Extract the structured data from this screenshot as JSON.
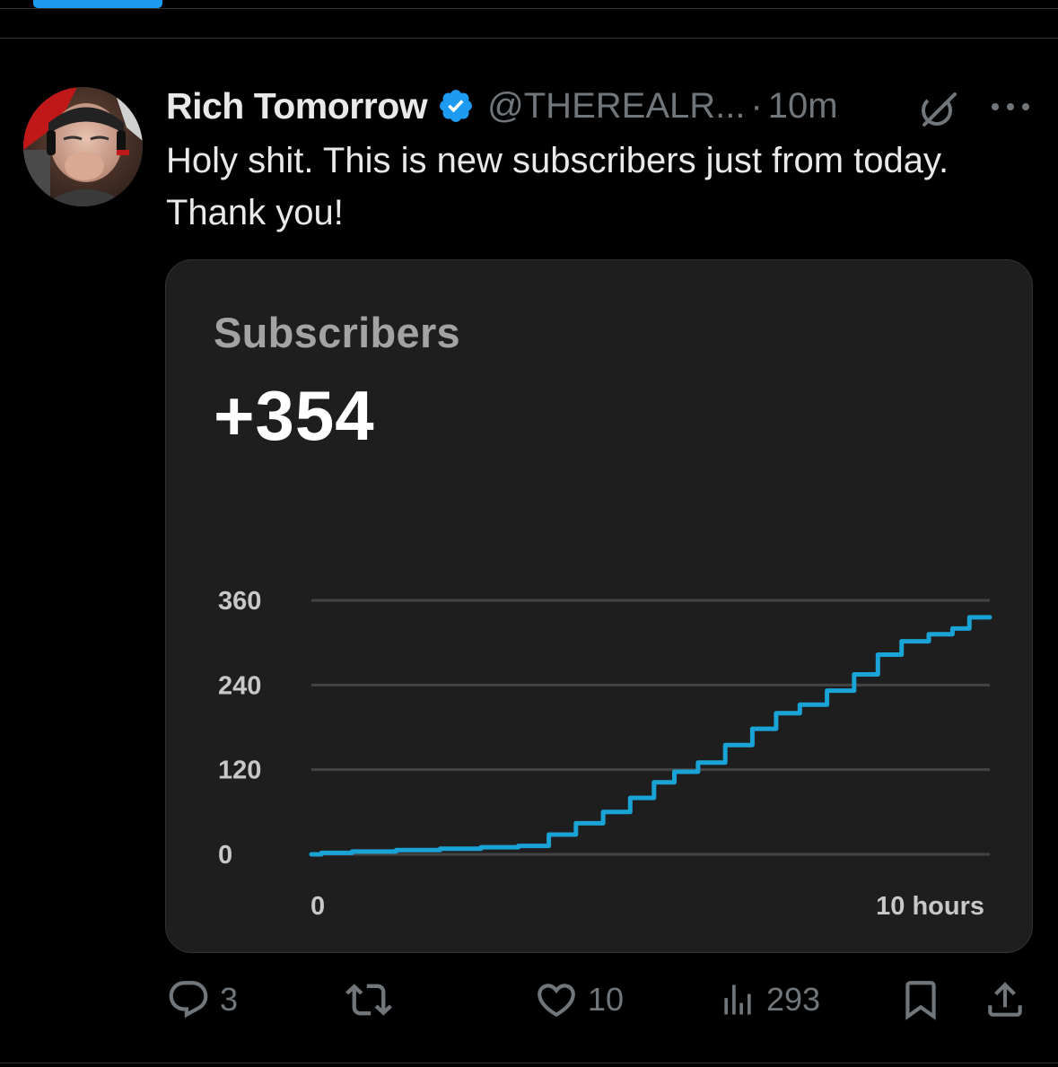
{
  "post": {
    "author": {
      "name": "Rich Tomorrow",
      "handle": "@THEREALR...",
      "verified": true,
      "verified_color": "#1d9bf0"
    },
    "separator": "·",
    "time": "10m",
    "text": "Holy shit. This is new subscribers just from today. Thank you!",
    "icons": {
      "grok": "grok-icon",
      "more": "more-icon"
    }
  },
  "card": {
    "title": "Subscribers",
    "value": "+354"
  },
  "chart_data": {
    "type": "line",
    "title": "",
    "xlabel": "",
    "ylabel": "",
    "x_tick_labels": [
      "0",
      "10 hours"
    ],
    "y_ticks": [
      0,
      120,
      240,
      360
    ],
    "xlim": [
      0,
      10
    ],
    "ylim": [
      0,
      360
    ],
    "grid": true,
    "line_color": "#1aa3d6",
    "series": [
      {
        "x": [
          0,
          0.3,
          0.9,
          1.6,
          2.2,
          2.8,
          3.3,
          3.7,
          4.1,
          4.5,
          4.9,
          5.2,
          5.5,
          5.9,
          6.3,
          6.7,
          7.0,
          7.4,
          7.8,
          8.2,
          8.5,
          8.9,
          9.3,
          9.6,
          9.8,
          10.0
        ],
        "y": [
          0,
          2,
          4,
          6,
          8,
          10,
          12,
          28,
          44,
          60,
          80,
          102,
          117,
          130,
          155,
          178,
          200,
          212,
          232,
          255,
          283,
          302,
          312,
          320,
          336,
          336
        ]
      }
    ]
  },
  "actions": {
    "reply": {
      "icon": "reply-icon",
      "count": "3"
    },
    "repost": {
      "icon": "repost-icon",
      "count": ""
    },
    "like": {
      "icon": "heart-icon",
      "count": "10"
    },
    "views": {
      "icon": "views-icon",
      "count": "293"
    },
    "bookmark": {
      "icon": "bookmark-icon"
    },
    "share": {
      "icon": "share-icon"
    }
  },
  "colors": {
    "background": "#000000",
    "text": "#e7e9ea",
    "muted": "#71767b",
    "accent": "#1d9bf0",
    "card_bg": "#1e1e1e"
  }
}
